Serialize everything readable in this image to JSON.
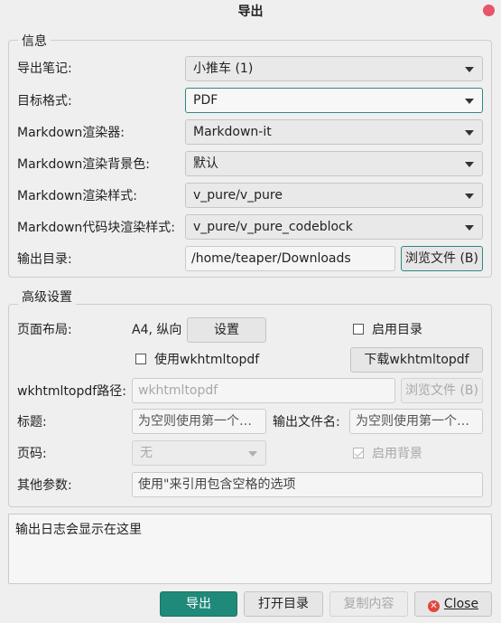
{
  "window": {
    "title": "导出"
  },
  "info": {
    "legend": "信息",
    "rows": [
      {
        "label": "导出笔记:",
        "value": "小推车 (1)"
      },
      {
        "label": "目标格式:",
        "value": "PDF"
      },
      {
        "label": "Markdown渲染器:",
        "value": "Markdown-it"
      },
      {
        "label": "Markdown渲染背景色:",
        "value": "默认"
      },
      {
        "label": "Markdown渲染样式:",
        "value": "v_pure/v_pure"
      },
      {
        "label": "Markdown代码块渲染样式:",
        "value": "v_pure/v_pure_codeblock"
      }
    ],
    "output_dir": {
      "label": "输出目录:",
      "value": "/home/teaper/Downloads",
      "browse": "浏览文件 (B)"
    }
  },
  "advanced": {
    "legend": "高级设置",
    "page_layout": {
      "label": "页面布局:",
      "value": "A4, 纵向",
      "button": "设置"
    },
    "enable_toc": "启用目录",
    "use_wkhtmltopdf": "使用wkhtmltopdf",
    "download_wkhtmltopdf": "下载wkhtmltopdf",
    "wk_path": {
      "label": "wkhtmltopdf路径:",
      "placeholder": "wkhtmltopdf",
      "browse": "浏览文件 (B)"
    },
    "title": {
      "label": "标题:",
      "placeholder": "为空则使用第一个…"
    },
    "output_file": {
      "label": "输出文件名:",
      "placeholder": "为空则使用第一个…"
    },
    "page_number": {
      "label": "页码:",
      "value": "无"
    },
    "enable_background": "启用背景",
    "other_params": {
      "label": "其他参数:",
      "placeholder": "使用\"来引用包含空格的选项"
    }
  },
  "log": {
    "text": "输出日志会显示在这里"
  },
  "footer": {
    "export": "导出",
    "open_dir": "打开目录",
    "copy": "复制内容",
    "close": "Close"
  }
}
